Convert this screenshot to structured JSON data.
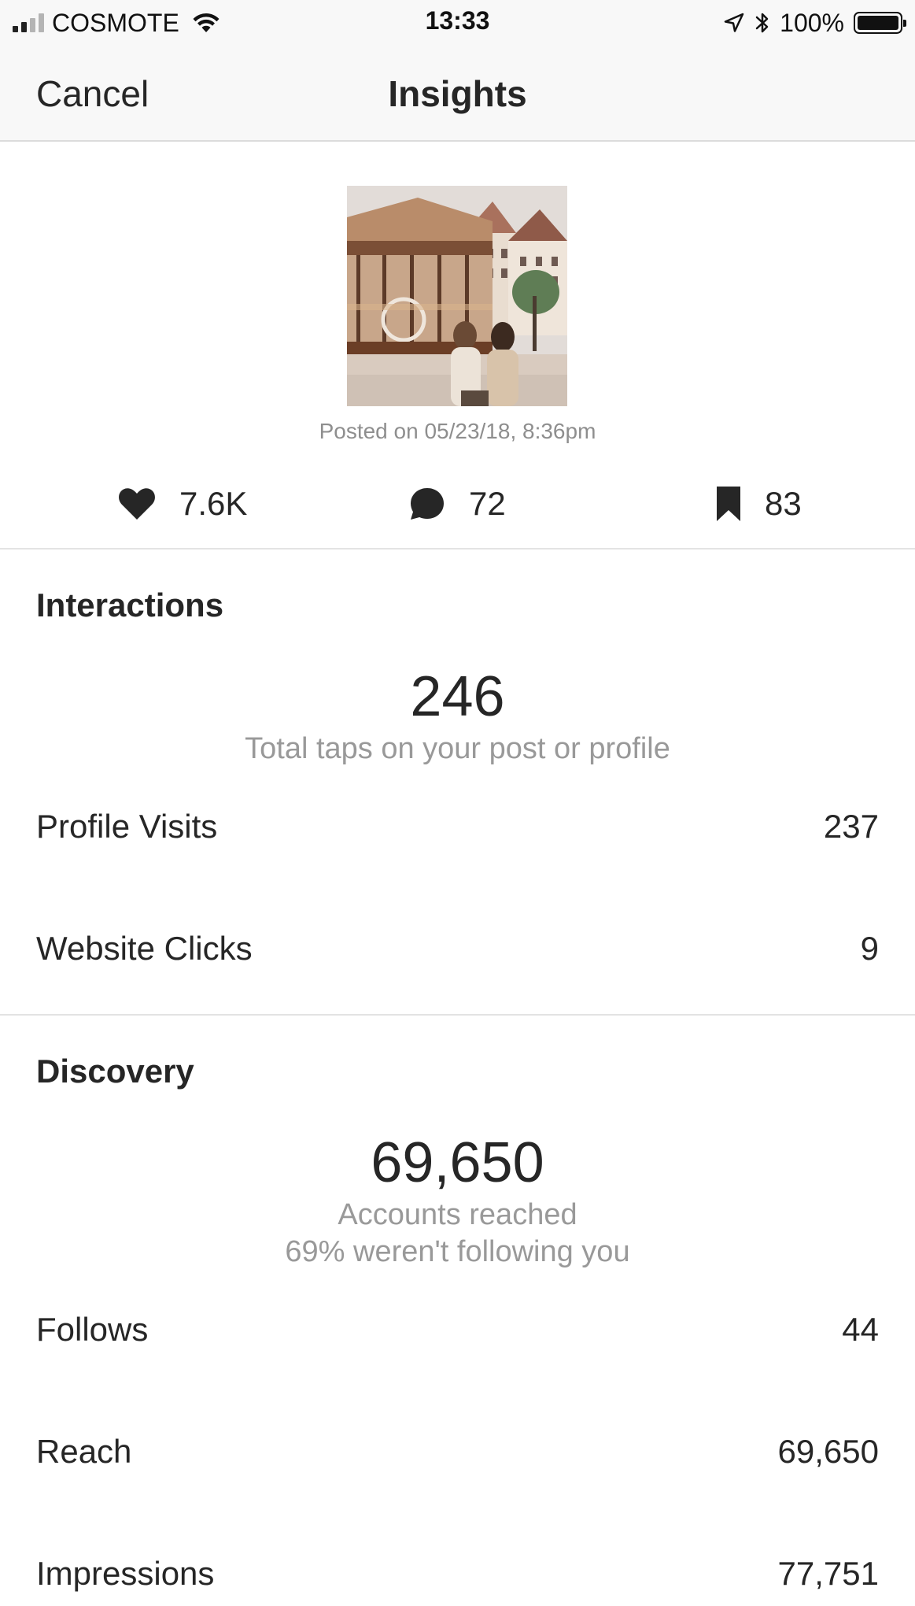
{
  "status_bar": {
    "carrier": "COSMOTE",
    "time": "13:33",
    "battery_percent": "100%",
    "battery_level": 1.0,
    "signal_bars": 2,
    "signal_bars_total": 4
  },
  "nav": {
    "cancel_label": "Cancel",
    "title": "Insights"
  },
  "post": {
    "posted_on": "Posted on 05/23/18, 8:36pm"
  },
  "counts": {
    "likes": "7.6K",
    "comments": "72",
    "saves": "83"
  },
  "interactions": {
    "title": "Interactions",
    "total": "246",
    "total_caption": "Total taps on your post or profile",
    "rows": [
      {
        "label": "Profile Visits",
        "value": "237"
      },
      {
        "label": "Website Clicks",
        "value": "9"
      }
    ]
  },
  "discovery": {
    "title": "Discovery",
    "total": "69,650",
    "caption_1": "Accounts reached",
    "caption_2": "69% weren't following you",
    "rows": [
      {
        "label": "Follows",
        "value": "44"
      },
      {
        "label": "Reach",
        "value": "69,650"
      },
      {
        "label": "Impressions",
        "value": "77,751"
      }
    ]
  },
  "colors": {
    "text": "#262626",
    "muted": "#999999",
    "bar_bg": "#f8f8f8"
  }
}
